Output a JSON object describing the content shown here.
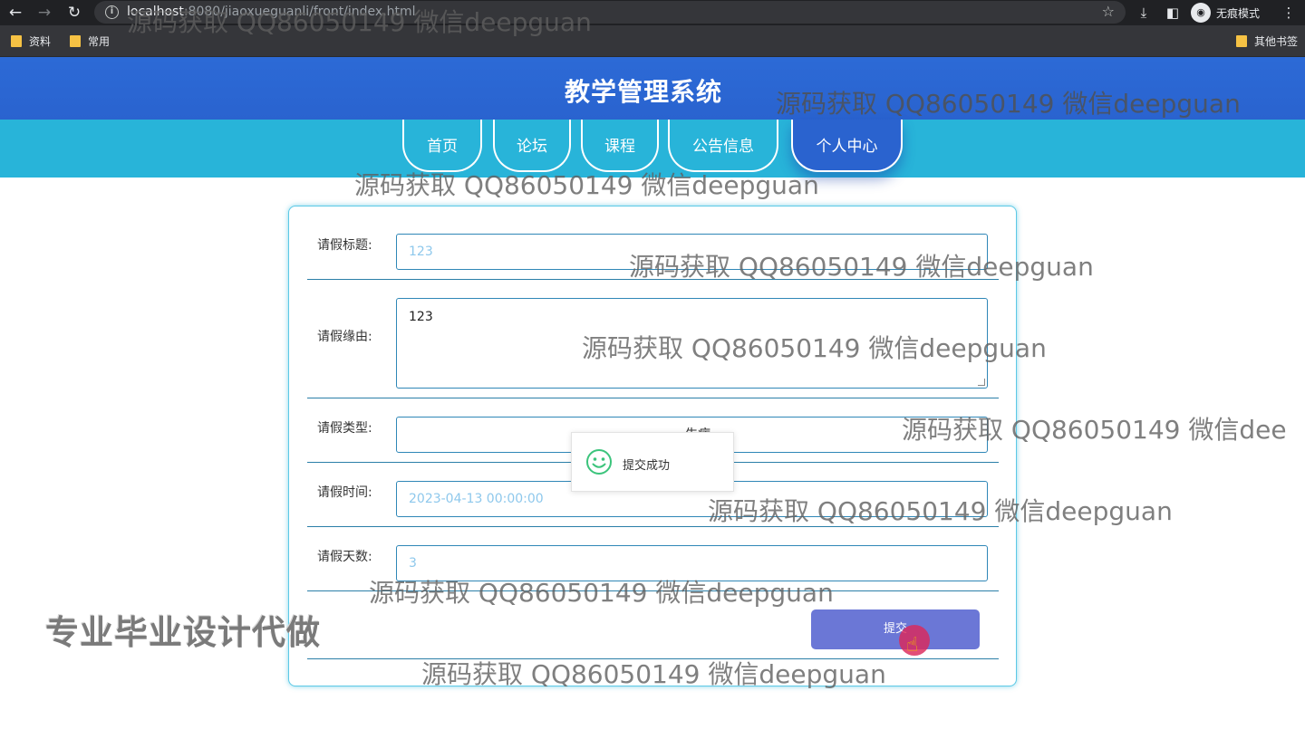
{
  "browser": {
    "url_host": "localhost",
    "url_path": ":8080/jiaoxueguanli/front/index.html",
    "incognito_label": "无痕模式",
    "bookmarks": [
      "资料",
      "常用"
    ],
    "other_bookmarks": "其他书签"
  },
  "site": {
    "title": "教学管理系统",
    "nav": [
      "首页",
      "论坛",
      "课程",
      "公告信息",
      "个人中心"
    ],
    "active_nav": "个人中心"
  },
  "form": {
    "title_label": "请假标题:",
    "title_value": "123",
    "reason_label": "请假缘由:",
    "reason_value": "123",
    "type_label": "请假类型:",
    "type_value": "生病",
    "time_label": "请假时间:",
    "time_value": "2023-04-13 00:00:00",
    "days_label": "请假天数:",
    "days_value": "3",
    "submit_label": "提交"
  },
  "toast": {
    "message": "提交成功",
    "icon": "smile-icon",
    "color": "#3cc47c"
  },
  "overlay": {
    "watermark_text": "源码获取 QQ86050149 微信deepguan",
    "watermark_partial": "源码获取 QQ86050149 微信dee",
    "promo": "专业毕业设计代做"
  },
  "colors": {
    "header": "#2a63cf",
    "nav_bar": "#28b4d9",
    "card_border": "#5cc9e6",
    "submit": "#6b77d6"
  }
}
